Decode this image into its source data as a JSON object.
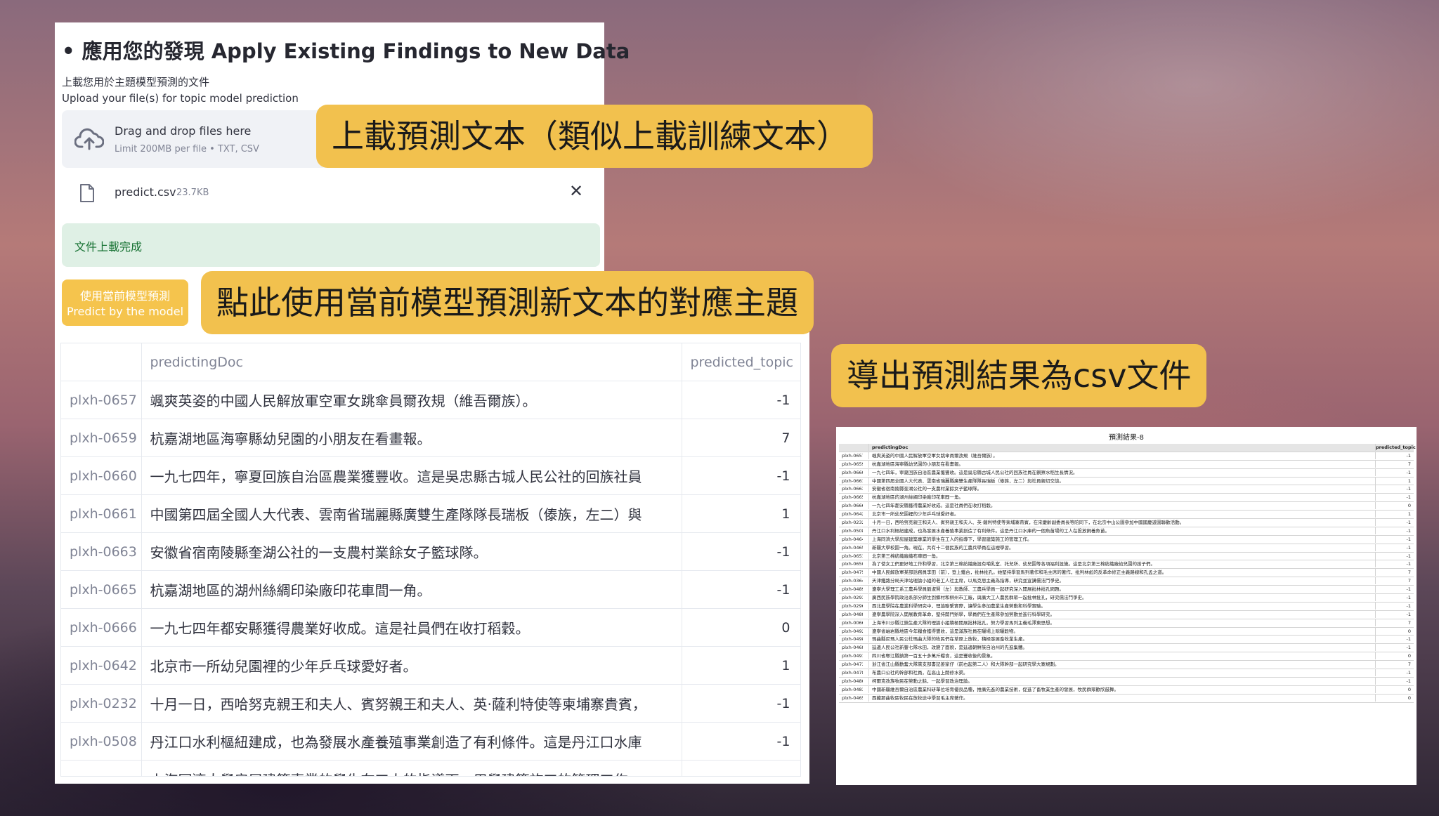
{
  "app": {
    "heading": "• 應用您的發現 Apply Existing Findings to New Data",
    "upload_label_zh": "上載您用於主題模型預測的文件",
    "upload_label_en": "Upload your file(s) for topic model prediction"
  },
  "uploader": {
    "title": "Drag and drop files here",
    "limit": "Limit 200MB per file • TXT, CSV",
    "icon": "cloud-upload-icon"
  },
  "file": {
    "name": "predict.csv",
    "size": "23.7KB",
    "close": "✕"
  },
  "status": {
    "success": "文件上載完成"
  },
  "predict_button": {
    "label_zh": "使用當前模型預測",
    "label_en": "Predict by the model",
    "color": "#f5c44d"
  },
  "table": {
    "columns": [
      "",
      "predictingDoc",
      "predicted_topic"
    ],
    "rows": [
      {
        "id": "plxh-0657",
        "doc": "颯爽英姿的中國人民解放軍空軍女跳傘員爾孜規（維吾爾族）。",
        "topic": "-1"
      },
      {
        "id": "plxh-0659",
        "doc": "杭嘉湖地區海寧縣幼兒園的小朋友在看畫報。",
        "topic": "7"
      },
      {
        "id": "plxh-0660",
        "doc": "一九七四年，寧夏回族自治區農業獲豐收。這是吳忠縣古城人民公社的回族社員",
        "topic": "-1"
      },
      {
        "id": "plxh-0661",
        "doc": "中國第四屆全國人大代表、雲南省瑞麗縣廣雙生產隊隊長瑞板（傣族，左二）與",
        "topic": "1"
      },
      {
        "id": "plxh-0663",
        "doc": "安徽省宿南陵縣奎湖公社的一支農村業餘女子籃球隊。",
        "topic": "-1"
      },
      {
        "id": "plxh-0665",
        "doc": "杭嘉湖地區的湖州絲綢印染廠印花車間一角。",
        "topic": "-1"
      },
      {
        "id": "plxh-0666",
        "doc": "一九七四年都安縣獲得農業好收成。這是社員們在收打稻穀。",
        "topic": "0"
      },
      {
        "id": "plxh-0642",
        "doc": "北京市一所幼兒園裡的少年乒乓球愛好者。",
        "topic": "1"
      },
      {
        "id": "plxh-0232",
        "doc": "十月一日，西哈努克親王和夫人、賓努親王和夫人、英·薩利特使等柬埔寨貴賓，",
        "topic": "-1"
      },
      {
        "id": "plxh-0508",
        "doc": "丹江口水利樞紐建成，也為發展水產養殖事業創造了有利條件。這是丹江口水庫",
        "topic": "-1"
      },
      {
        "id": "",
        "doc": "上海同濟大學房屋建築專業的學生在工人的指導下，用學建築施工的管理工作。",
        "topic": ""
      }
    ]
  },
  "callouts": {
    "upload": "上載預測文本（類似上載訓練文本）",
    "predict": "點此使用當前模型預測新文本的對應主題",
    "export": "導出預測結果為csv文件",
    "color": "#f2c14e"
  },
  "preview": {
    "title": "預測結果-8",
    "columns": [
      "",
      "predictingDoc",
      "predicted_topic"
    ],
    "rows": [
      {
        "id": "plxh-0657",
        "doc": "颯爽英姿的中國人民解放軍空軍女跳傘員爾孜規（維吾爾族）。",
        "topic": "-1"
      },
      {
        "id": "plxh-0659",
        "doc": "杭嘉湖地區海寧縣幼兒園的小朋友在看畫報。",
        "topic": "7"
      },
      {
        "id": "plxh-0660",
        "doc": "一九七四年，寧夏回族自治區農業獲豐收。這是吳忠縣古城人民公社的回族社員在觀察水稻生長情況。",
        "topic": "-1"
      },
      {
        "id": "plxh-0661",
        "doc": "中國第四屆全國人大代表、雲南省瑞麗縣廣雙生產隊隊長瑞板（傣族，左二）與社員親切交談。",
        "topic": "1"
      },
      {
        "id": "plxh-0663",
        "doc": "安徽省宿南陵縣奎湖公社的一支農村業餘女子籃球隊。",
        "topic": "-1"
      },
      {
        "id": "plxh-0665",
        "doc": "杭嘉湖地區的湖州絲綢印染廠印花車間一角。",
        "topic": "-1"
      },
      {
        "id": "plxh-0666",
        "doc": "一九七四年都安縣獲得農業好收成。這是社員們在收打稻穀。",
        "topic": "0"
      },
      {
        "id": "plxh-0642",
        "doc": "北京市一所幼兒園裡的少年乒乓球愛好者。",
        "topic": "1"
      },
      {
        "id": "plxh-0232",
        "doc": "十月一日，西哈努克親王和夫人、賓努親王和夫人、英·薩利特使等柬埔寨貴賓，在宋慶齡副委員長等陪同下，在北京中山公園參加中國國慶遊園聯歡活動。",
        "topic": "-1"
      },
      {
        "id": "plxh-0508",
        "doc": "丹江口水利樞紐建成，也為發展水產養殖事業創造了有利條件。這是丹江口水庫的一個魚苗場的工人在投放飼養魚苗。",
        "topic": "-1"
      },
      {
        "id": "plxh-0464",
        "doc": "上海同濟大學房屋建築專業的學生在工人的指導下，學習建築施工的管理工作。",
        "topic": "-1"
      },
      {
        "id": "plxh-0465",
        "doc": "新疆大學校園一角。現在，共有十二個民族的工農兵學員在這裡學習。",
        "topic": "-1"
      },
      {
        "id": "plxh-0651",
        "doc": "北京第三棉紡織廠織布車間一角。",
        "topic": "-1"
      },
      {
        "id": "plxh-0650",
        "doc": "為了使女工們更好地工作和學習，北京第三棉紡織廠設有哺乳室、托兒所、幼兒園等各項福利設施。這是北京第三棉紡織廠幼兒園的孩子們。",
        "topic": "-1"
      },
      {
        "id": "plxh-0475",
        "doc": "中國人民解放軍某部話務員李田（前），登上鐵台，批林批孔。她堅持學習馬列著作和毛主席的著作，批判林彪的反革命修正主義路線和孔孟之道。",
        "topic": "7"
      },
      {
        "id": "plxh-0364",
        "doc": "天津鐵路分局天津站理論小組的老工人社主席，以馬克思主義為指導，研究並宣講儒法鬥爭史。",
        "topic": "7"
      },
      {
        "id": "plxh-0489",
        "doc": "遼寧大學理工系工農兵學員劉淑賢（左）與教師、工農兵學員一起研究深入開展批林批孔問題。",
        "topic": "-1"
      },
      {
        "id": "plxh-0293",
        "doc": "廣西民族學院政治系部分師生到鄉村和柳州市工廠，與廣大工人農民群眾一起批林批孔，研究儒法鬥爭史。",
        "topic": "-1"
      },
      {
        "id": "plxh-0296",
        "doc": "西北農學院在農業科學研究中，理論聯繫實際，讓學生參加農業生產勞動和科學實驗。",
        "topic": "-1"
      },
      {
        "id": "plxh-0488",
        "doc": "遼寧農學院深入開展教育革命，堅持開門辦學，學員們在生產隊參加勞動並進行科學研究。",
        "topic": "-1"
      },
      {
        "id": "plxh-0066",
        "doc": "上海市川沙縣江鎮生產大隊的理論小組積極開展批林批孔，努力學習馬列主義毛澤東思想。",
        "topic": "7"
      },
      {
        "id": "plxh-0492",
        "doc": "遼寧省岫岩縣地區今年糧食獲得豐收，這是滿族社員在曬場上晾曬穀物。",
        "topic": "0"
      },
      {
        "id": "plxh-0498",
        "doc": "瑪曲縣尼瑪人民公社瑪曲大隊的牧民們在草原上放牧，積極發展畜牧業生產。",
        "topic": "-1"
      },
      {
        "id": "plxh-0468",
        "doc": "延邊人民公社新豐七隊水田，改變了面貌，是延邊朝鮮族自治州的先進集體。",
        "topic": "-1"
      },
      {
        "id": "plxh-0491",
        "doc": "四川省郫江縣鎮第一百五十多萬斤糧食，這是豐收後的景象。",
        "topic": "0"
      },
      {
        "id": "plxh-0473",
        "doc": "浙江省江山縣勤奮大隊黨支部書記姜家仔（前右起第二人）和大隊幹部一起研究學大寨規劃。",
        "topic": "7"
      },
      {
        "id": "plxh-0478",
        "doc": "布農口公社的幹部和社員，在高山上開修水渠。",
        "topic": "-1"
      },
      {
        "id": "plxh-0480",
        "doc": "柯爾克孜族牧民在勞動之餘，一起學習政治理論。",
        "topic": "-1"
      },
      {
        "id": "plxh-0483",
        "doc": "中國新疆維吾爾自治區農業科研單位培育優良品種，推廣先進的農業技術，促進了畜牧業生產的發展，牧民群眾歡欣鼓舞。",
        "topic": "0"
      },
      {
        "id": "plxh-0465",
        "doc": "西藏那曲牧區牧民在放牧途中學習毛主席著作。",
        "topic": "0"
      }
    ]
  }
}
